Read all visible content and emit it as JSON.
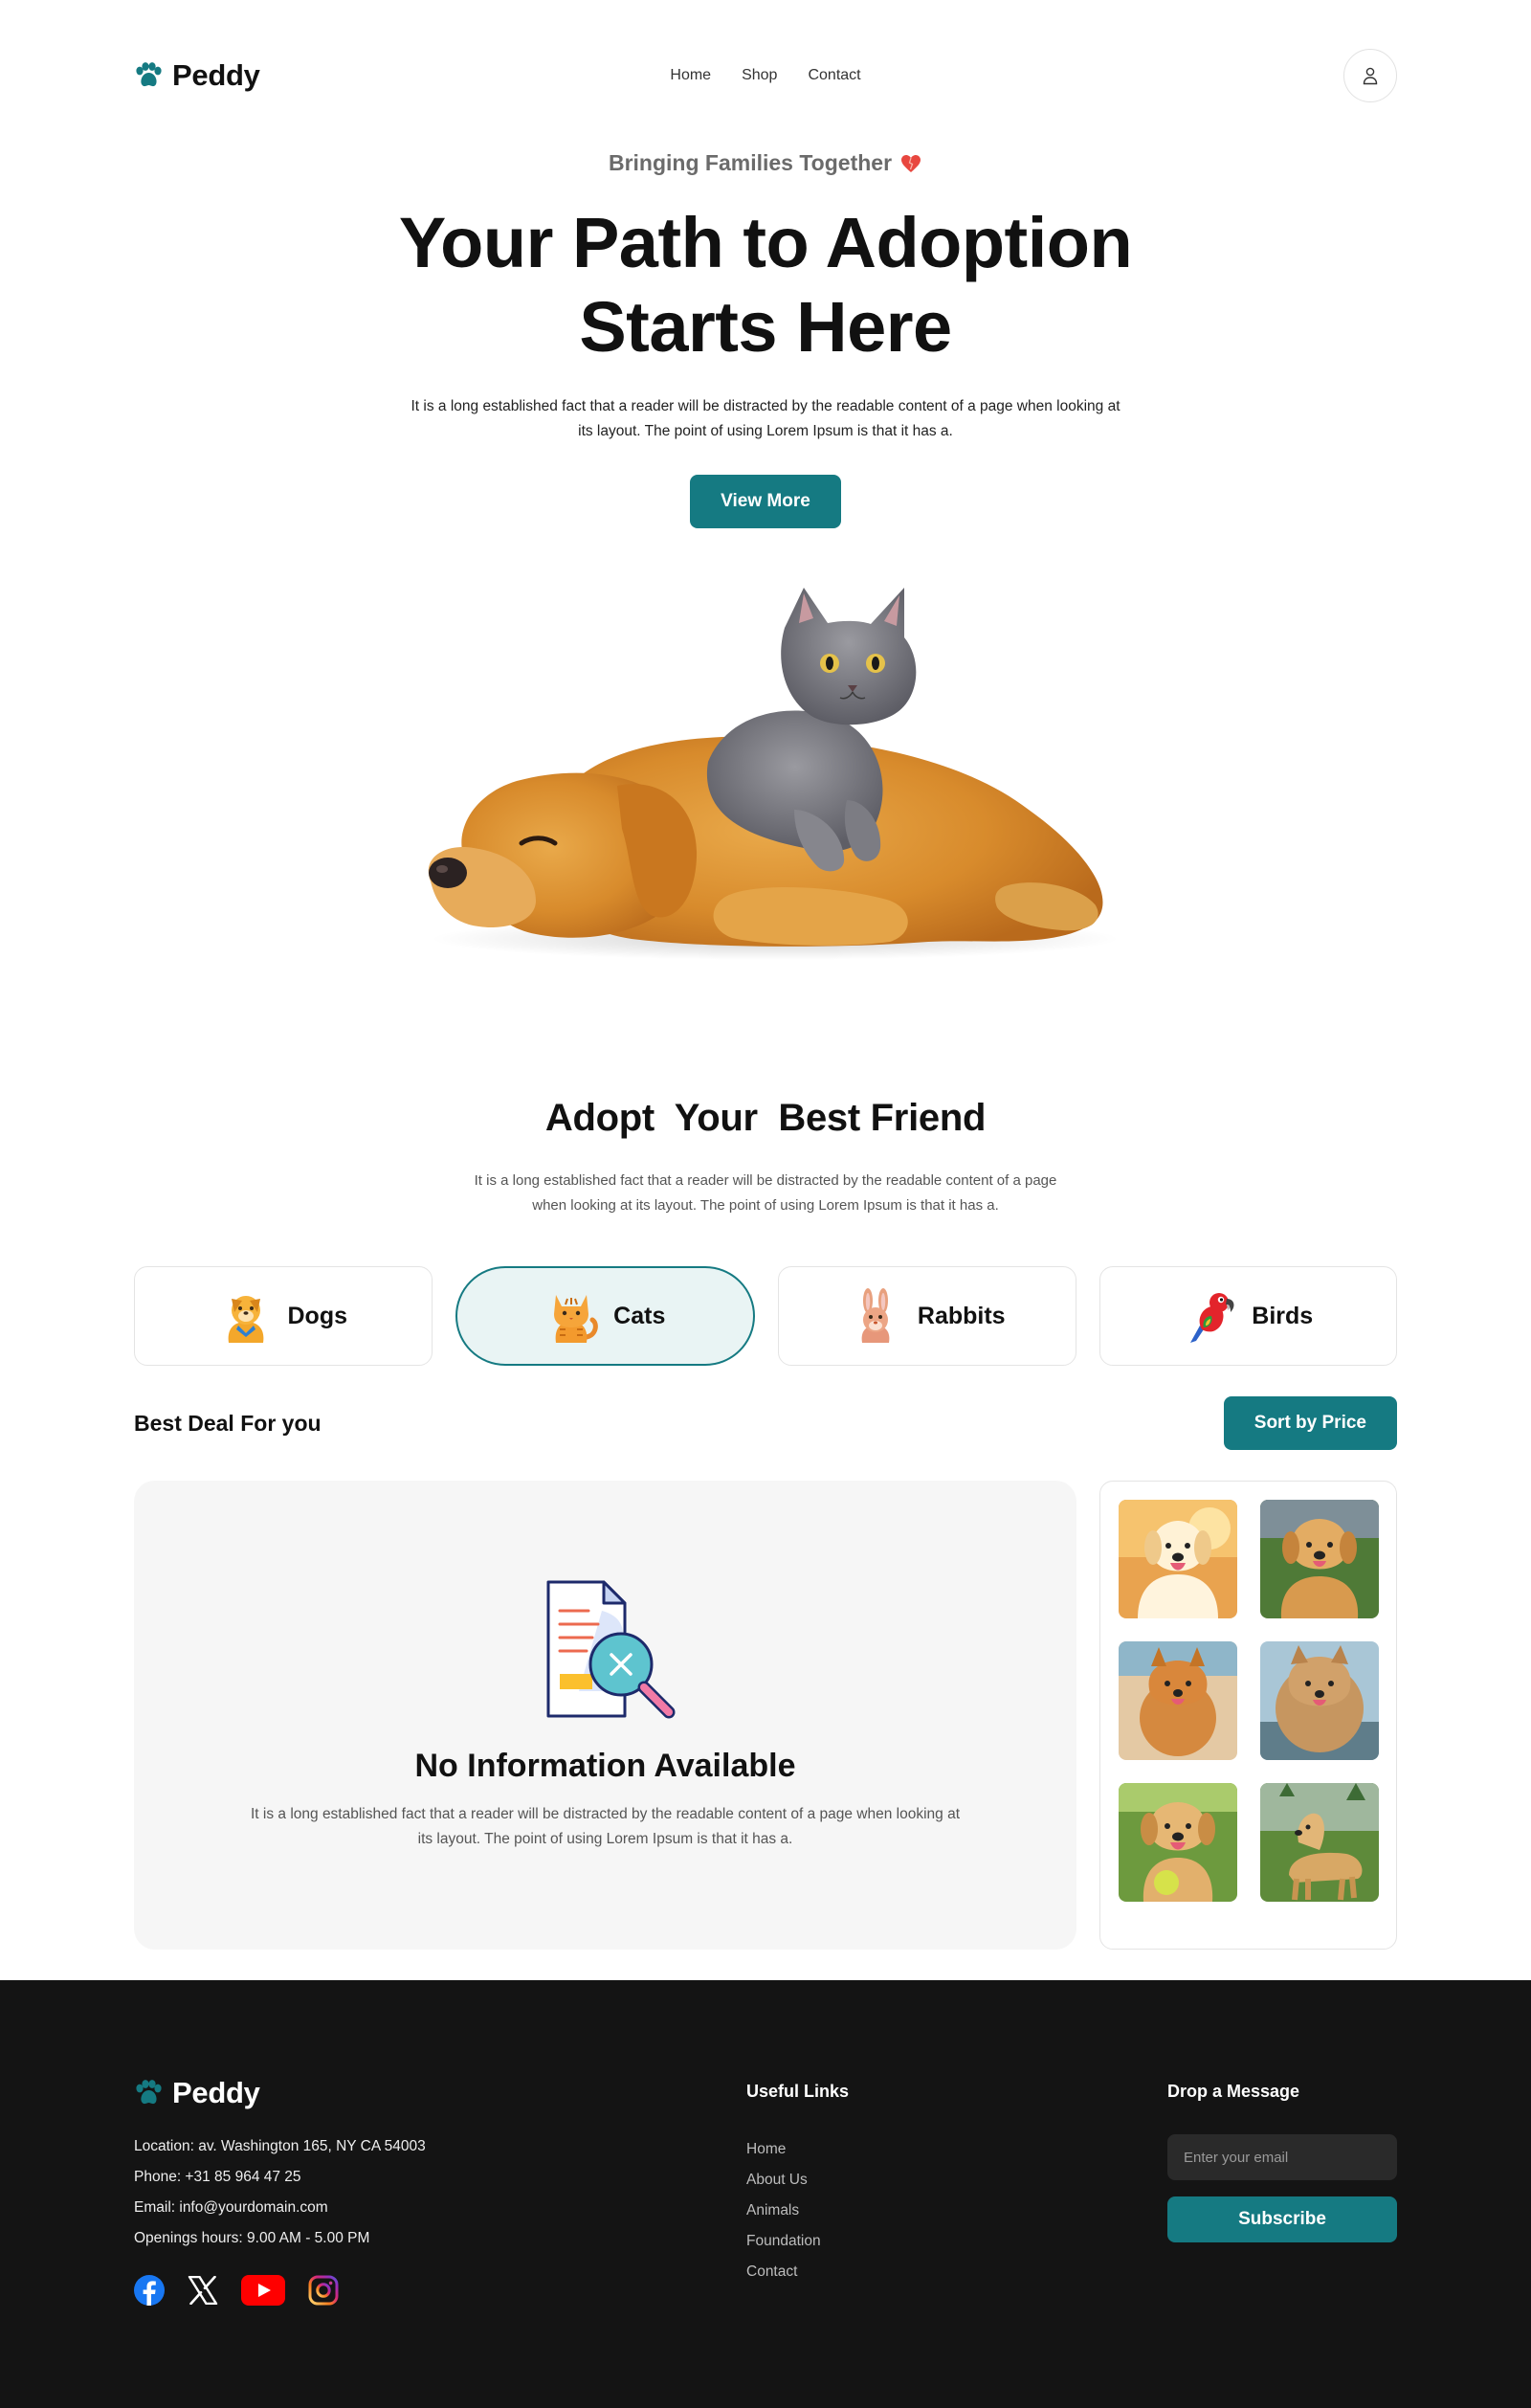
{
  "brand": {
    "name": "Peddy",
    "accent": "#157a82"
  },
  "nav": {
    "links": [
      "Home",
      "Shop",
      "Contact"
    ]
  },
  "hero": {
    "eyebrow": "Bringing Families Together",
    "title_line1": "Your Path to Adoption",
    "title_line2": "Starts Here",
    "lead": "It is a long established fact that a reader will be distracted by the readable content of a page when looking at its layout. The point of using Lorem Ipsum is that it has a.",
    "cta": "View More"
  },
  "adopt": {
    "title": "Adopt  Your  Best Friend",
    "text": "It is a long established fact that a reader will be distracted by the readable content of a page when looking at its layout. The point of using Lorem Ipsum is that it has a.",
    "categories": [
      {
        "label": "Dogs",
        "icon": "dog-icon"
      },
      {
        "label": "Cats",
        "icon": "cat-icon"
      },
      {
        "label": "Rabbits",
        "icon": "rabbit-icon"
      },
      {
        "label": "Birds",
        "icon": "parrot-icon"
      }
    ],
    "active_category": "Cats"
  },
  "deals": {
    "title": "Best Deal For you",
    "sort_label": "Sort by Price",
    "empty_title": "No Information Available",
    "empty_text": "It is a long established fact that a reader will be distracted by the readable content of a page when looking at its layout. The point of using Lorem Ipsum is that it has a."
  },
  "footer": {
    "location": "Location: av. Washington 165, NY CA 54003",
    "phone": "Phone: +31 85 964 47 25",
    "email": "Email: info@yourdomain.com",
    "hours": "Openings hours: 9.00 AM - 5.00 PM",
    "links_title": "Useful Links",
    "links": [
      "Home",
      "About Us",
      "Animals",
      "Foundation",
      "Contact"
    ],
    "message_title": "Drop a Message",
    "email_placeholder": "Enter your email",
    "subscribe": "Subscribe"
  }
}
